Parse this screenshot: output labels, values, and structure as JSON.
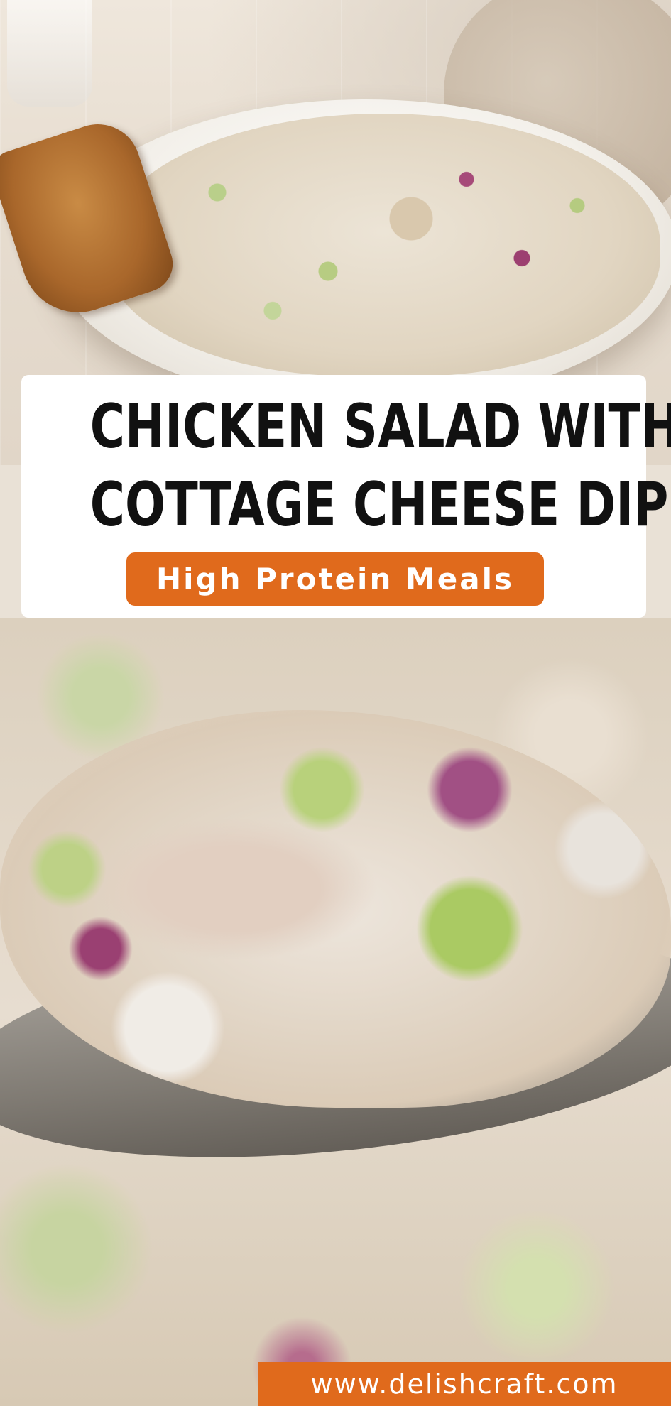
{
  "pin": {
    "title_line_1": "CHICKEN SALAD WITH",
    "title_line_2": "COTTAGE CHEESE DIP",
    "tag": "High Protein Meals",
    "website": "www.delishcraft.com"
  },
  "colors": {
    "accent_orange": "#e06a1c",
    "title_text": "#111111",
    "card_background": "#ffffff"
  }
}
